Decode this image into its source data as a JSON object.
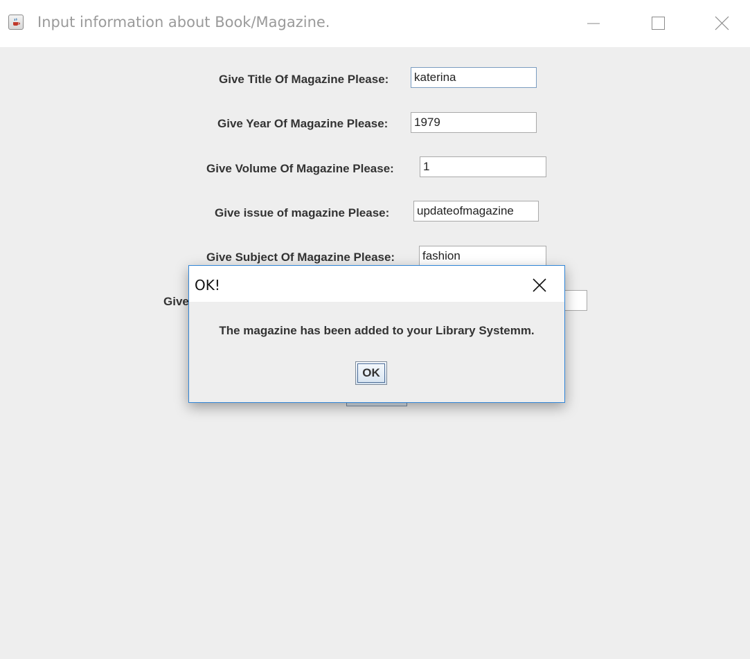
{
  "window": {
    "title": "Input information about Book/Magazine.",
    "icon": "java-cup-icon"
  },
  "form": {
    "fields": [
      {
        "label": "Give Title Of Magazine Please:",
        "value": "katerina"
      },
      {
        "label": "Give Year Of Magazine Please:",
        "value": "1979"
      },
      {
        "label": "Give Volume Of Magazine Please:",
        "value": "1"
      },
      {
        "label": "Give issue of magazine Please:",
        "value": "updateofmagazine"
      },
      {
        "label": "Give Subject Of Magazine Please:",
        "value": "fashion"
      },
      {
        "label": "Give",
        "value": ""
      }
    ]
  },
  "dialog": {
    "title": "OK!",
    "message": "The magazine has been added to your Library Systemm.",
    "ok_label": "OK"
  },
  "colors": {
    "accent_border": "#2f84d6",
    "background": "#eeeeee"
  }
}
